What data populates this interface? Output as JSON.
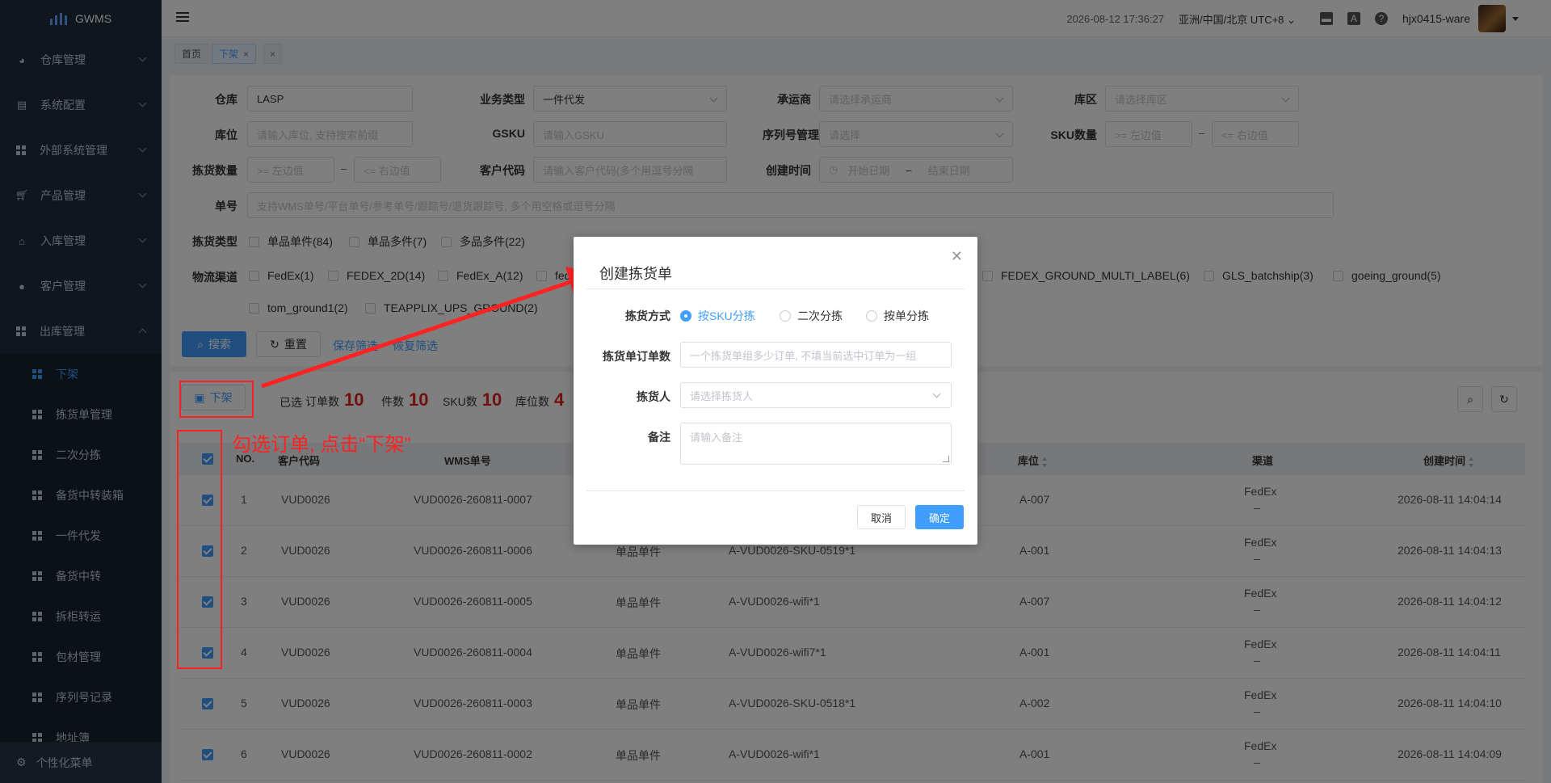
{
  "app": {
    "name": "GWMS"
  },
  "sidebar": {
    "groups": [
      {
        "label": "仓库管理",
        "icon": "globe-icon"
      },
      {
        "label": "系统配置",
        "icon": "config-icon"
      },
      {
        "label": "外部系统管理",
        "icon": "grid-icon"
      },
      {
        "label": "产品管理",
        "icon": "cart-icon"
      },
      {
        "label": "入库管理",
        "icon": "home-icon"
      },
      {
        "label": "客户管理",
        "icon": "user-icon"
      },
      {
        "label": "出库管理",
        "icon": "grid-icon"
      }
    ],
    "subitems": [
      "下架",
      "拣货单管理",
      "二次分拣",
      "备货中转装箱",
      "一件代发",
      "备货中转",
      "拆柜转运",
      "包材管理",
      "序列号记录",
      "地址簿"
    ],
    "bottom": "个性化菜单"
  },
  "topbar": {
    "datetime": "2026-08-12 17:36:27",
    "timezone": "亚洲/中国/北京 UTC+8",
    "username": "hjx0415-ware"
  },
  "tabs": {
    "home": "首页",
    "current": "下架"
  },
  "filters": {
    "warehouse": {
      "label": "仓库",
      "value": "LASP"
    },
    "biz_type": {
      "label": "业务类型",
      "value": "一件代发"
    },
    "carrier": {
      "label": "承运商",
      "placeholder": "请选择承运商"
    },
    "zone": {
      "label": "库区",
      "placeholder": "请选择库区"
    },
    "location": {
      "label": "库位",
      "placeholder": "请输入库位, 支持搜索前缀"
    },
    "gsku": {
      "label": "GSKU",
      "placeholder": "请输入GSKU"
    },
    "serial": {
      "label": "序列号管理",
      "placeholder": "请选择"
    },
    "sku_qty": {
      "label": "SKU数量",
      "min": ">= 左边值",
      "max": "<= 右边值"
    },
    "pick_qty": {
      "label": "拣货数量",
      "min": ">= 左边值",
      "max": "<= 右边值"
    },
    "customer": {
      "label": "客户代码",
      "placeholder": "请输入客户代码(多个用逗号分隔"
    },
    "created": {
      "label": "创建时间",
      "start": "开始日期",
      "end": "结束日期",
      "sep": "–"
    },
    "order_no": {
      "label": "单号",
      "placeholder": "支持WMS单号/平台单号/参考单号/跟踪号/退货跟踪号, 多个用空格或逗号分隔"
    },
    "range_sep": "–",
    "pick_type": {
      "label": "拣货类型",
      "options": [
        "单品单件(84)",
        "单品多件(7)",
        "多品多件(22)"
      ]
    },
    "channel": {
      "label": "物流渠道",
      "options_row1": [
        "FedEx(1)",
        "FEDEX_2D(14)",
        "FedEx_A(12)",
        "fed"
      ],
      "options_right": [
        "FEDEX_GROUND_MULTI_LABEL(6)",
        "GLS_batchship(3)",
        "goeing_ground(5)"
      ],
      "options_row2": [
        "tom_ground1(2)",
        "TEAPPLIX_UPS_GROUND(2)"
      ]
    },
    "search_btn": "搜索",
    "reset_btn": "重置",
    "save_link": "保存筛选",
    "restore_link": "恢复筛选"
  },
  "toolbar": {
    "offshelf_btn": "下架",
    "selected": "已选",
    "orders_label": "订单数",
    "orders": "10",
    "pieces_label": "件数",
    "pieces": "10",
    "sku_label": "SKU数",
    "sku": "10",
    "loc_label": "库位数",
    "loc": "4"
  },
  "table": {
    "headers": {
      "no": "NO.",
      "customer": "客户代码",
      "wms": "WMS单号",
      "location": "库位",
      "channel": "渠道",
      "created": "创建时间"
    },
    "rows": [
      {
        "no": "1",
        "customer": "VUD0026",
        "wms": "VUD0026-260811-0007",
        "type": "",
        "sku": "",
        "location": "A-007",
        "channel": "FedEx",
        "channel2": "–",
        "created": "2026-08-11 14:04:14"
      },
      {
        "no": "2",
        "customer": "VUD0026",
        "wms": "VUD0026-260811-0006",
        "type": "单品单件",
        "sku": "A-VUD0026-SKU-0519*1",
        "location": "A-001",
        "channel": "FedEx",
        "channel2": "–",
        "created": "2026-08-11 14:04:13"
      },
      {
        "no": "3",
        "customer": "VUD0026",
        "wms": "VUD0026-260811-0005",
        "type": "单品单件",
        "sku": "A-VUD0026-wifi*1",
        "location": "A-007",
        "channel": "FedEx",
        "channel2": "–",
        "created": "2026-08-11 14:04:12"
      },
      {
        "no": "4",
        "customer": "VUD0026",
        "wms": "VUD0026-260811-0004",
        "type": "单品单件",
        "sku": "A-VUD0026-wifi7*1",
        "location": "A-001",
        "channel": "FedEx",
        "channel2": "–",
        "created": "2026-08-11 14:04:11"
      },
      {
        "no": "5",
        "customer": "VUD0026",
        "wms": "VUD0026-260811-0003",
        "type": "单品单件",
        "sku": "A-VUD0026-SKU-0518*1",
        "location": "A-002",
        "channel": "FedEx",
        "channel2": "–",
        "created": "2026-08-11 14:04:10"
      },
      {
        "no": "6",
        "customer": "VUD0026",
        "wms": "VUD0026-260811-0002",
        "type": "单品单件",
        "sku": "A-VUD0026-wifi*1",
        "location": "A-001",
        "channel": "FedEx",
        "channel2": "–",
        "created": "2026-08-11 14:04:09"
      }
    ]
  },
  "annotation": {
    "text": "勾选订单, 点击“下架”",
    "color": "#ff2222"
  },
  "dialog": {
    "title": "创建拣货单",
    "method_label": "拣货方式",
    "methods": [
      "按SKU分拣",
      "二次分拣",
      "按单分拣"
    ],
    "count_label": "拣货单订单数",
    "count_placeholder": "一个拣货单组多少订单, 不填当前选中订单为一组",
    "picker_label": "拣货人",
    "picker_placeholder": "请选择拣货人",
    "remark_label": "备注",
    "remark_placeholder": "请输入备注",
    "cancel": "取消",
    "confirm": "确定"
  },
  "colors": {
    "primary": "#409eff",
    "sidebar": "#1f2d3d",
    "annotation": "#ff2222"
  }
}
